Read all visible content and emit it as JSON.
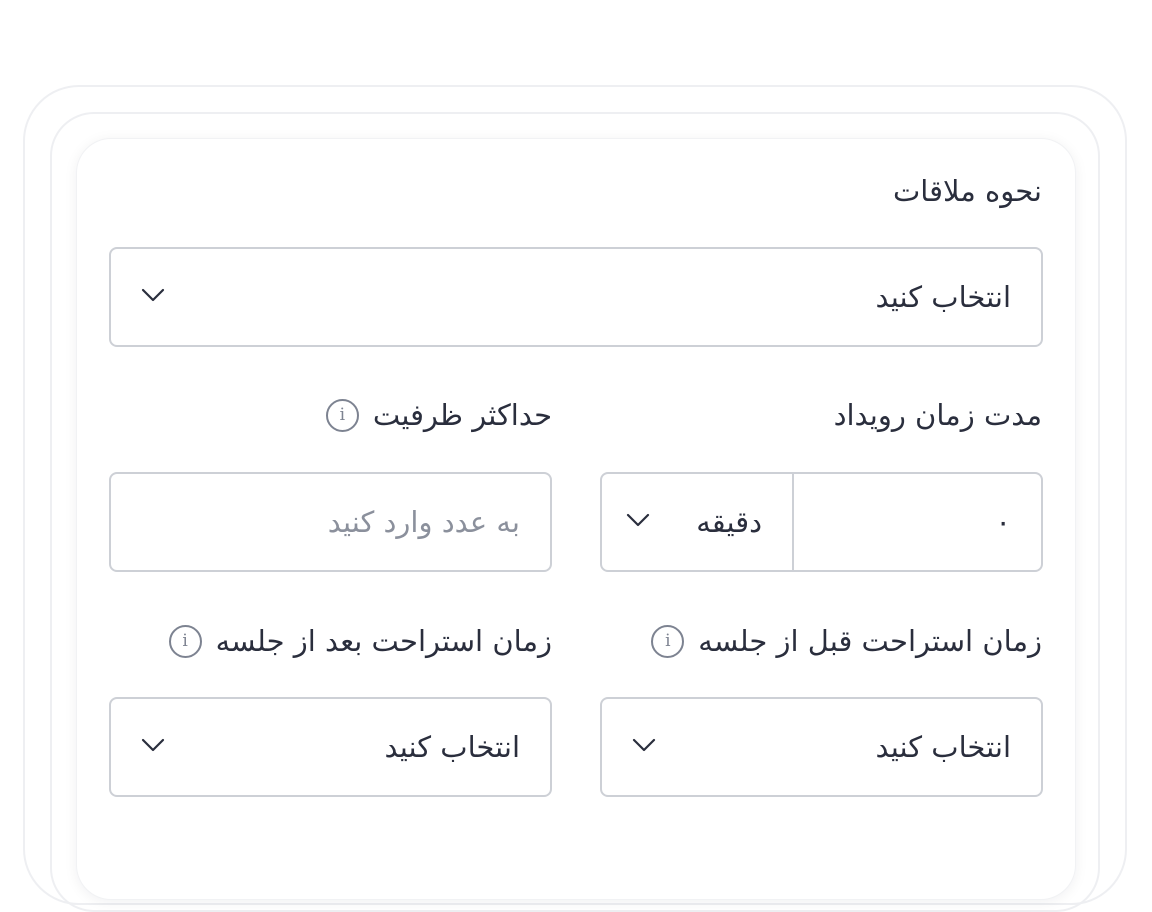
{
  "meeting_type": {
    "label": "نحوه ملاقات",
    "value": "انتخاب کنید"
  },
  "event_duration": {
    "label": "مدت زمان رویداد",
    "value": "۰",
    "unit": "دقیقه"
  },
  "max_capacity": {
    "label": "حداکثر ظرفیت",
    "placeholder": "به عدد وارد کنید"
  },
  "buffer_before": {
    "label": "زمان استراحت قبل از جلسه",
    "value": "انتخاب کنید"
  },
  "buffer_after": {
    "label": "زمان استراحت بعد از جلسه",
    "value": "انتخاب کنید"
  },
  "icons": {
    "info": "info-icon",
    "dropdown": "chevron-down-icon"
  },
  "colors": {
    "text": "#2a2e3d",
    "placeholder": "#8b909c",
    "border": "#cdd0d6",
    "icon": "#7d8391"
  }
}
